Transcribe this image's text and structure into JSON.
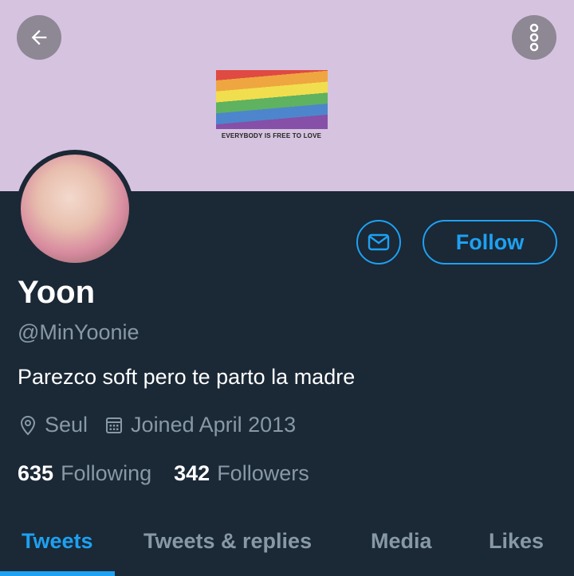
{
  "header": {
    "back_icon": "arrow-left-icon",
    "more_icon": "vertical-dots-icon",
    "banner_color": "#d6c3e0",
    "banner_caption": "EVERYBODY IS FREE TO LOVE"
  },
  "profile": {
    "name": "Yoon",
    "handle": "@MinYoonie",
    "bio": "Parezco soft pero te parto la madre",
    "location": "Seul",
    "joined": "Joined April 2013",
    "following_count": "635",
    "following_label": "Following",
    "followers_count": "342",
    "followers_label": "Followers"
  },
  "actions": {
    "message_icon": "envelope-icon",
    "follow_label": "Follow",
    "accent_color": "#1da1f2"
  },
  "tabs": [
    {
      "label": "Tweets",
      "active": true
    },
    {
      "label": "Tweets & replies",
      "active": false
    },
    {
      "label": "Media",
      "active": false
    },
    {
      "label": "Likes",
      "active": false
    }
  ]
}
